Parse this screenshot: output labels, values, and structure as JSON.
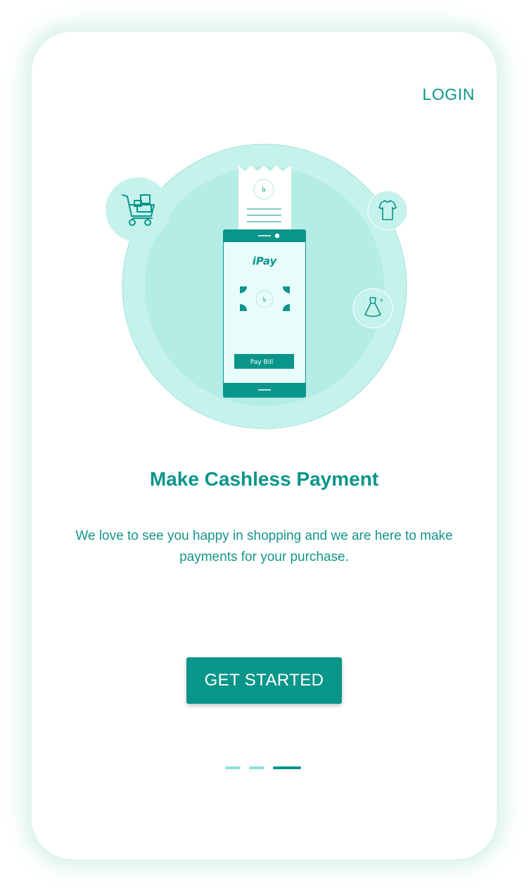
{
  "header": {
    "login_label": "LOGIN"
  },
  "illustration": {
    "receipt_symbol": "৳",
    "brand_text": "iPay",
    "note_symbol": "৳",
    "pay_button_label": "Pay Bill"
  },
  "content": {
    "title": "Make Cashless Payment",
    "description": "We love to see you happy in shopping and we are here to make payments for your purchase."
  },
  "cta": {
    "label": "GET STARTED"
  },
  "pagination": {
    "total": 3,
    "active_index": 2
  },
  "colors": {
    "primary": "#0a958a",
    "light_circle": "#c6f2ec",
    "inner_circle": "#b4ece6",
    "phone_screen": "#e8fdfb",
    "dot_inactive": "#8fe0d6"
  }
}
